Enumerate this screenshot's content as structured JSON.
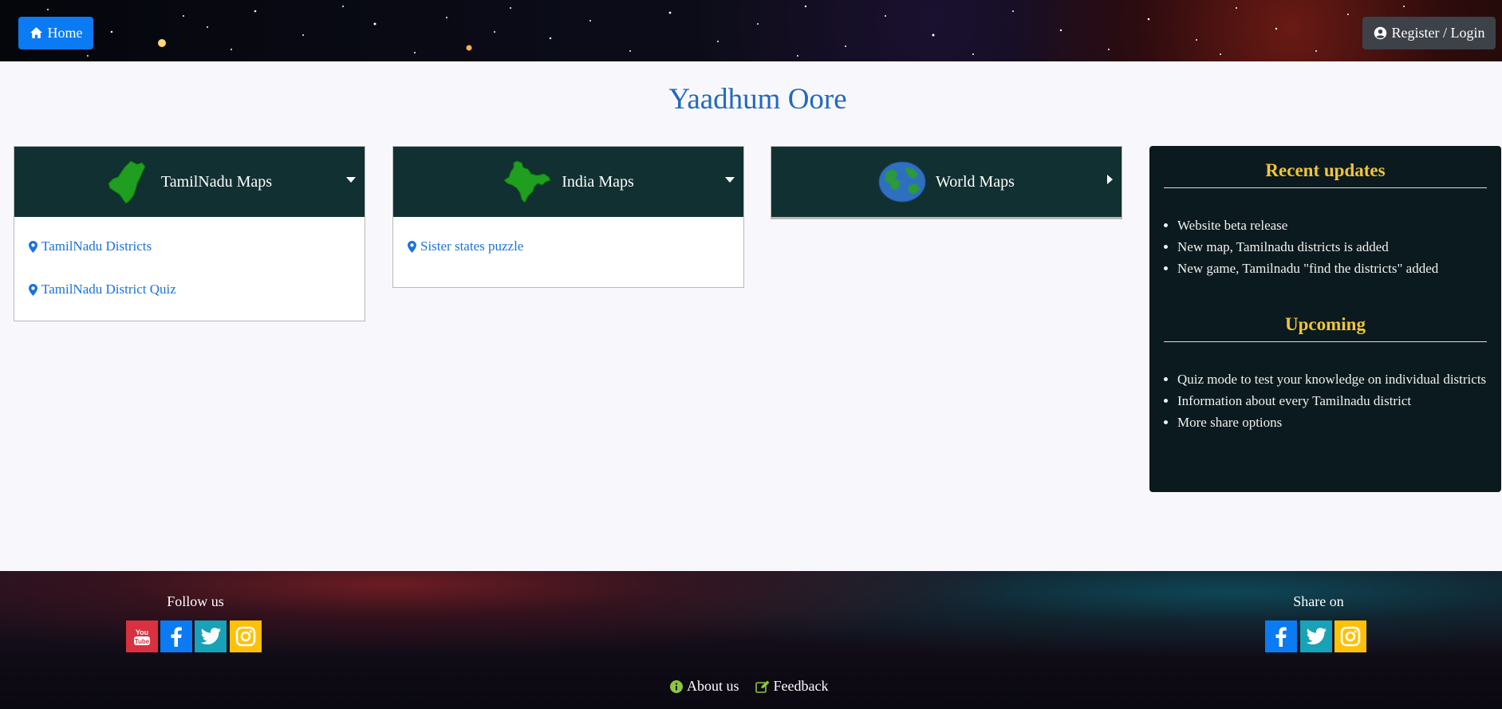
{
  "header": {
    "home_label": "Home",
    "login_label": "Register / Login"
  },
  "page_title": "Yaadhum Oore",
  "cards": [
    {
      "title": "TamilNadu Maps",
      "icon": "tamilnadu-map-icon",
      "links": [
        "TamilNadu Districts",
        "TamilNadu District Quiz"
      ]
    },
    {
      "title": "India Maps",
      "icon": "india-map-icon",
      "links": [
        "Sister states puzzle"
      ]
    },
    {
      "title": "World Maps",
      "icon": "globe-icon",
      "links": []
    }
  ],
  "sidebar": {
    "recent_heading": "Recent updates",
    "recent_items": [
      "Website beta release",
      "New map, Tamilnadu districts is added",
      "New game, Tamilnadu \"find the districts\" added"
    ],
    "upcoming_heading": "Upcoming",
    "upcoming_items": [
      "Quiz mode to test your knowledge on individual districts",
      "Information about every Tamilnadu district",
      "More share options"
    ]
  },
  "footer": {
    "follow_label": "Follow us",
    "share_label": "Share on",
    "about_label": "About us",
    "feedback_label": "Feedback"
  },
  "colors": {
    "accent": "#0a7bf2",
    "card_header": "#113031",
    "sidebar_bg": "#0b1a1e",
    "sidebar_heading": "#f0c53a",
    "title": "#2369bf",
    "youtube": "#d9313f",
    "facebook": "#0a7bf2",
    "twitter": "#17a2b8",
    "instagram": "#ffc107",
    "footer_icon": "#8dc63f"
  }
}
